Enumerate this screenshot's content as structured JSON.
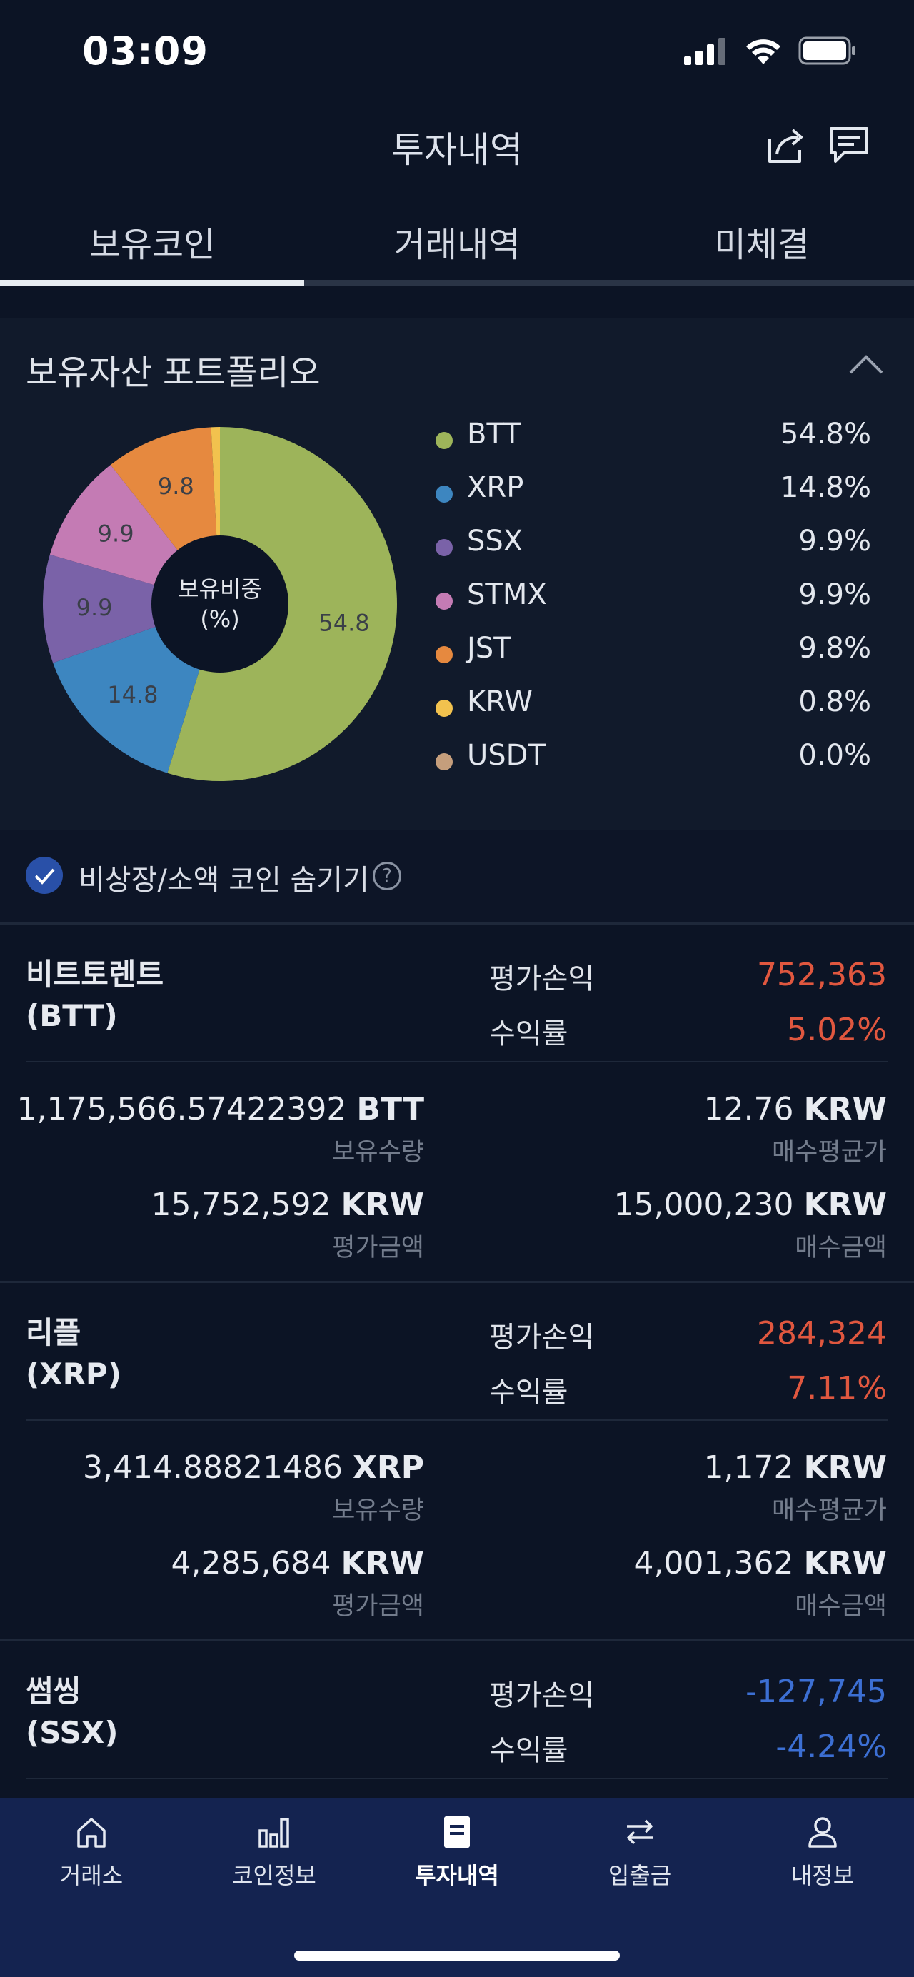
{
  "status_bar": {
    "time": "03:09"
  },
  "header": {
    "title": "투자내역"
  },
  "tabs": [
    {
      "label": "보유코인",
      "active": true
    },
    {
      "label": "거래내역",
      "active": false
    },
    {
      "label": "미체결",
      "active": false
    }
  ],
  "portfolio": {
    "title": "보유자산 포트폴리오",
    "center_label_line1": "보유비중",
    "center_label_line2": "(%)",
    "legend": [
      {
        "name": "BTT",
        "pct": "54.8%",
        "color": "#9db45a"
      },
      {
        "name": "XRP",
        "pct": "14.8%",
        "color": "#3d86c0"
      },
      {
        "name": "SSX",
        "pct": "9.9%",
        "color": "#7a62a8"
      },
      {
        "name": "STMX",
        "pct": "9.9%",
        "color": "#c47bb4"
      },
      {
        "name": "JST",
        "pct": "9.8%",
        "color": "#e6893f"
      },
      {
        "name": "KRW",
        "pct": "0.8%",
        "color": "#f2c24e"
      },
      {
        "name": "USDT",
        "pct": "0.0%",
        "color": "#c59e7c"
      }
    ],
    "slice_labels": [
      "54.8",
      "14.8",
      "9.9",
      "9.9",
      "9.8"
    ]
  },
  "chart_data": {
    "type": "pie",
    "title": "보유자산 포트폴리오",
    "categories": [
      "BTT",
      "XRP",
      "SSX",
      "STMX",
      "JST",
      "KRW",
      "USDT"
    ],
    "values": [
      54.8,
      14.8,
      9.9,
      9.9,
      9.8,
      0.8,
      0.0
    ],
    "colors": [
      "#9db45a",
      "#3d86c0",
      "#7a62a8",
      "#c47bb4",
      "#e6893f",
      "#f2c24e",
      "#c59e7c"
    ],
    "center_text": "보유비중 (%)"
  },
  "hide_option": {
    "label": "비상장/소액 코인 숨기기",
    "checked": true,
    "help": "?"
  },
  "labels": {
    "eval_pl": "평가손익",
    "yield": "수익률",
    "holding_qty": "보유수량",
    "avg_buy": "매수평균가",
    "eval_amount": "평가금액",
    "buy_amount": "매수금액"
  },
  "holdings": [
    {
      "name_kr": "비트토렌트",
      "symbol": "(BTT)",
      "eval_pl": "752,363",
      "yield": "5.02%",
      "qty": "1,175,566.57422392",
      "qty_unit": "BTT",
      "avg_price": "12.76",
      "avg_unit": "KRW",
      "eval_amount": "15,752,592",
      "eval_unit": "KRW",
      "buy_amount": "15,000,230",
      "buy_unit": "KRW"
    },
    {
      "name_kr": "리플",
      "symbol": "(XRP)",
      "eval_pl": "284,324",
      "yield": "7.11%",
      "qty": "3,414.88821486",
      "qty_unit": "XRP",
      "avg_price": "1,172",
      "avg_unit": "KRW",
      "eval_amount": "4,285,684",
      "eval_unit": "KRW",
      "buy_amount": "4,001,362",
      "buy_unit": "KRW"
    },
    {
      "name_kr": "썸씽",
      "symbol": "(SSX)",
      "eval_pl": "-127,745",
      "yield": "-4.24%"
    }
  ],
  "bottom_nav": [
    {
      "label": "거래소",
      "icon": "home-icon"
    },
    {
      "label": "코인정보",
      "icon": "bar-chart-icon"
    },
    {
      "label": "투자내역",
      "icon": "document-icon",
      "active": true
    },
    {
      "label": "입출금",
      "icon": "transfer-icon"
    },
    {
      "label": "내정보",
      "icon": "user-icon"
    }
  ]
}
